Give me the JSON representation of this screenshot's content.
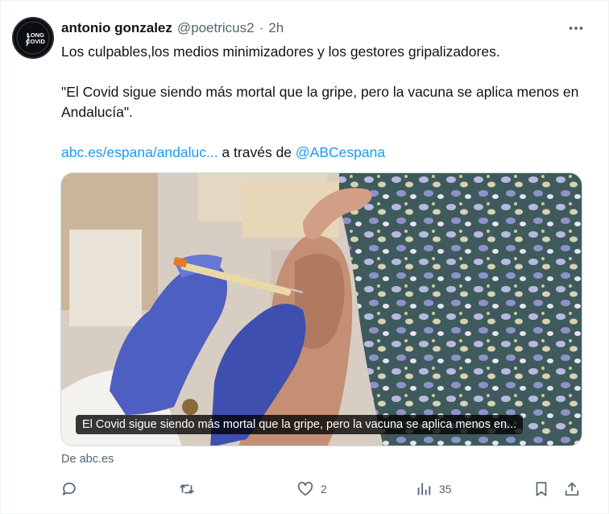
{
  "author": {
    "name": "antonio gonzalez",
    "handle": "@poetricus2",
    "separator": "·",
    "time": "2h",
    "avatar_logo_text_top": "LONG",
    "avatar_logo_text_bottom": "COVID"
  },
  "tweet": {
    "line1": "Los culpables,los medios minimizadores y los gestores gripalizadores.",
    "quote": "\"El Covid sigue siendo más mortal que la gripe, pero la vacuna se aplica menos en Andalucía\".",
    "link_text": "abc.es/espana/andaluc...",
    "via_text": " a través de ",
    "mention": "@ABCespana"
  },
  "card": {
    "caption": "El Covid sigue siendo más mortal que la gripe, pero la vacuna se aplica menos en...",
    "source": "De abc.es"
  },
  "actions": {
    "reply_count": "",
    "retweet_count": "",
    "like_count": "2",
    "views_count": "35"
  },
  "icons": {
    "more": "more-horizontal-icon",
    "reply": "reply-icon",
    "retweet": "retweet-icon",
    "like": "heart-icon",
    "views": "views-icon",
    "bookmark": "bookmark-icon",
    "share": "share-icon"
  },
  "colors": {
    "link": "#1d9bf0",
    "secondary_text": "#536471",
    "primary_text": "#0f1419",
    "caption_bg": "#000000"
  }
}
